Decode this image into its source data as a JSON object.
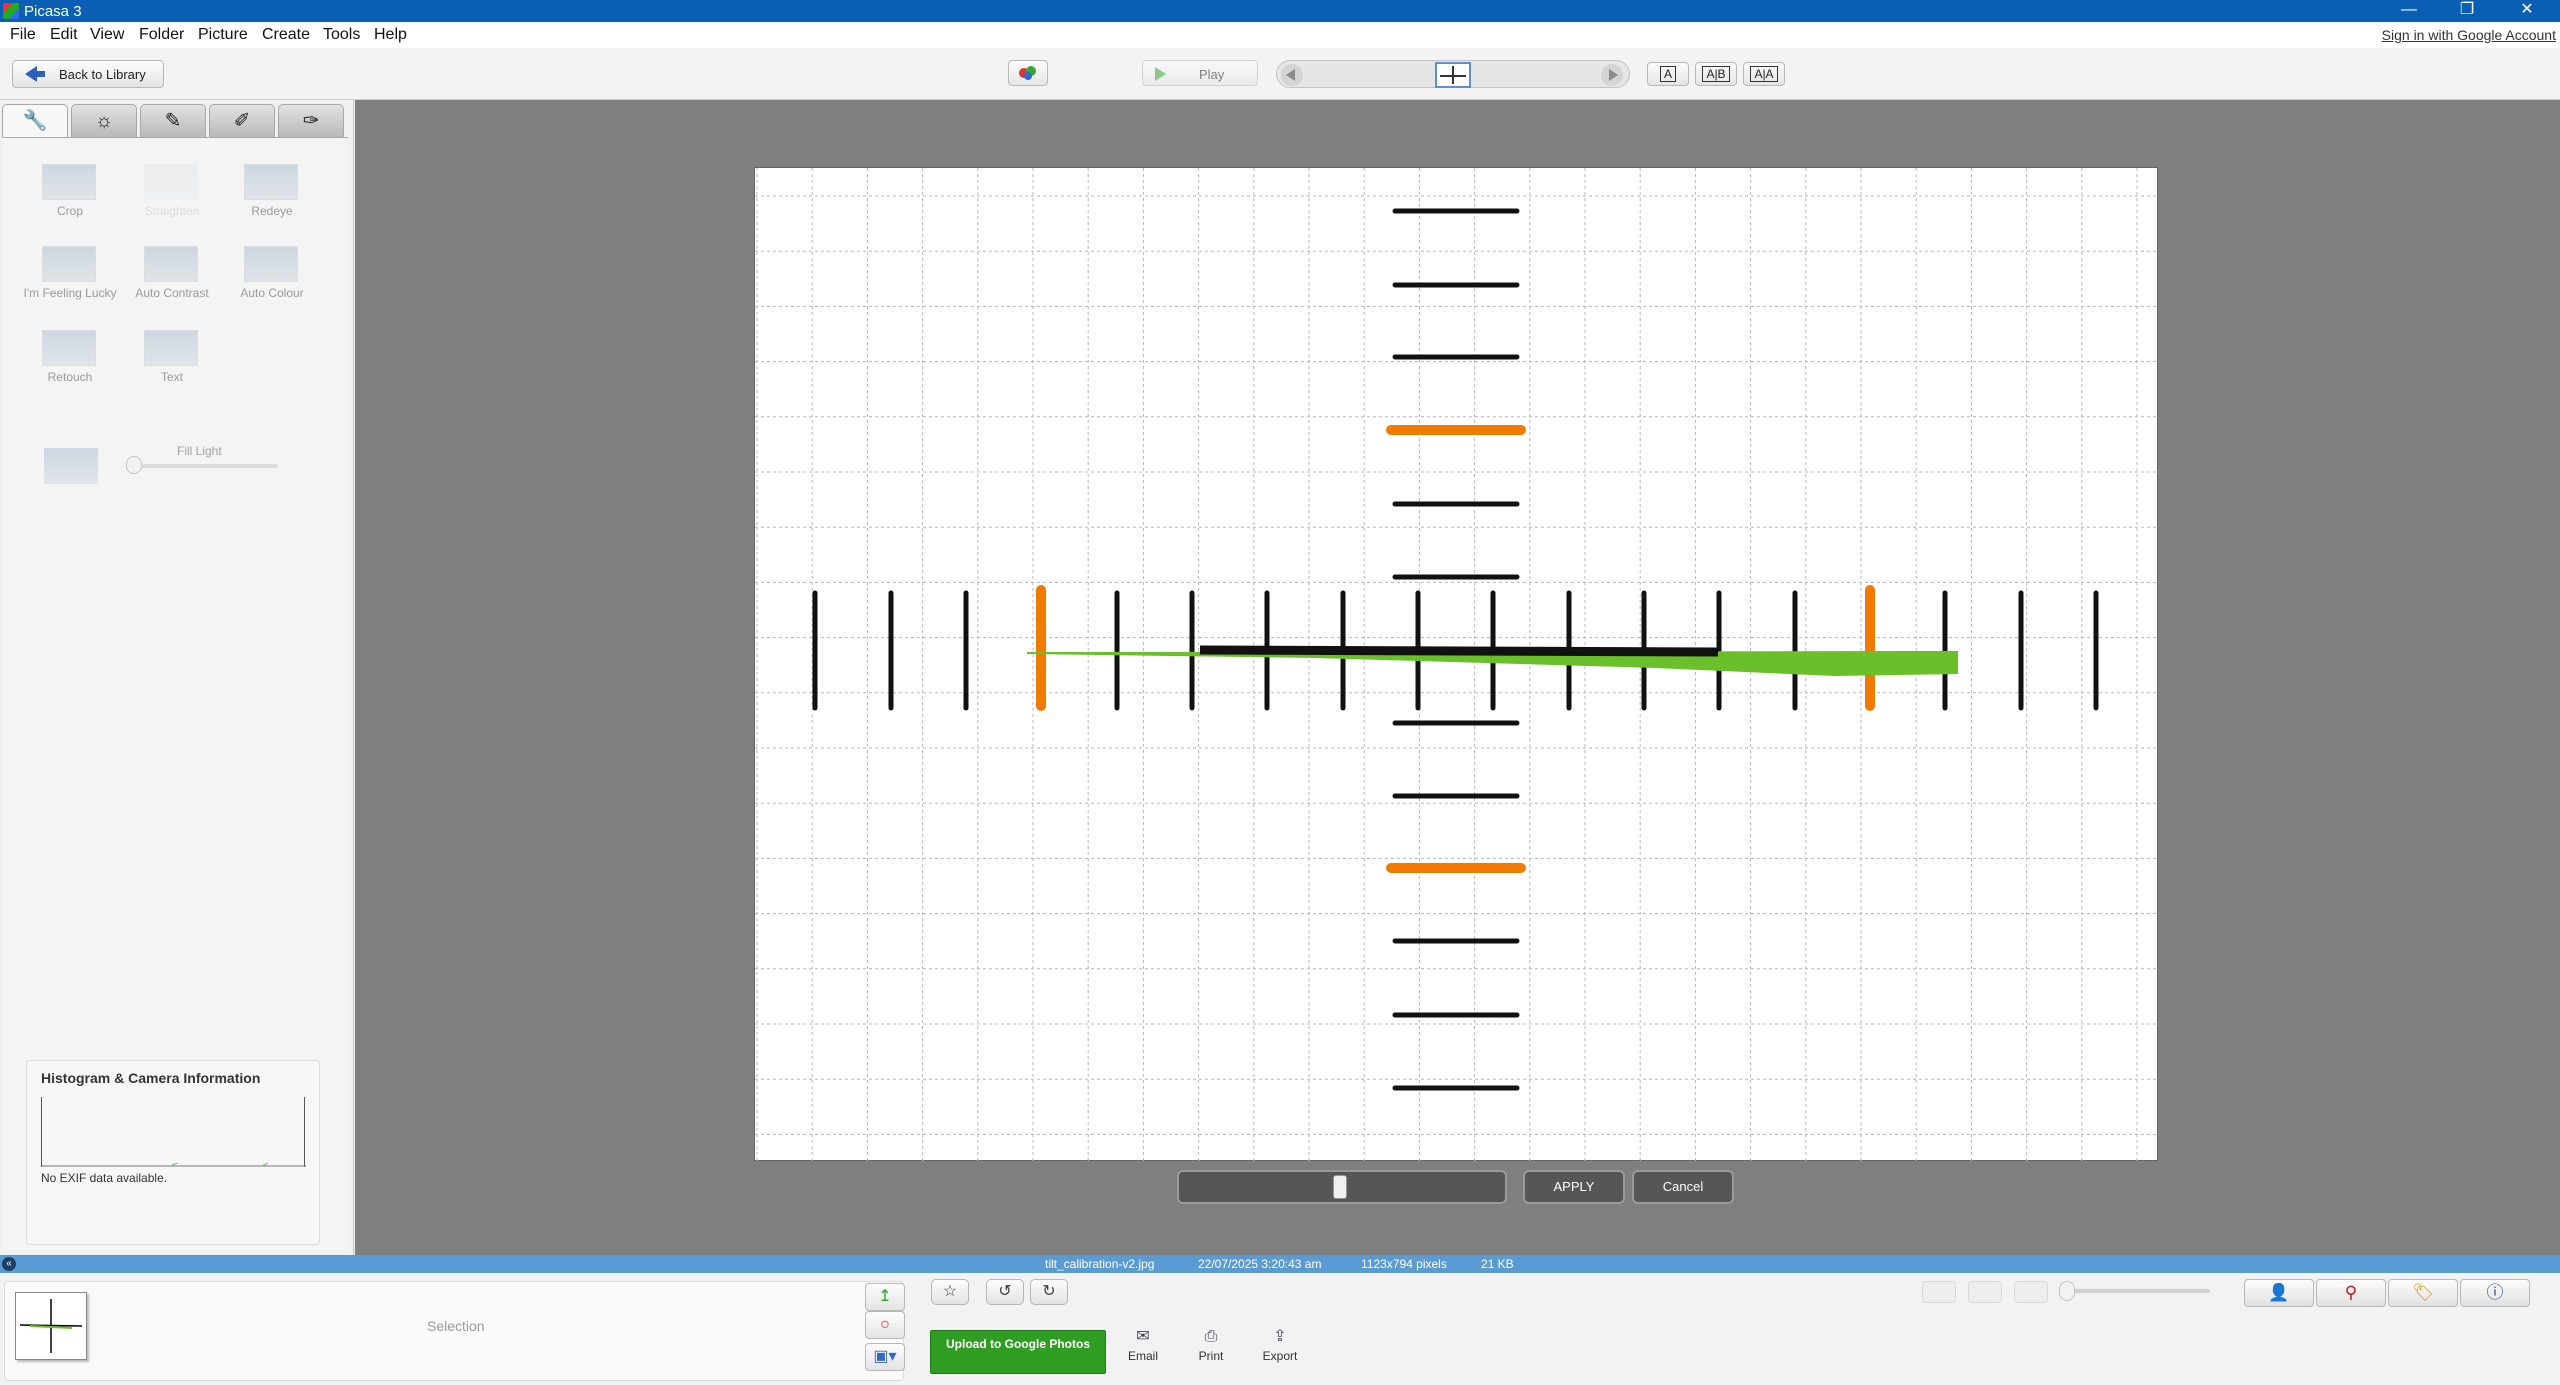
{
  "window": {
    "title": "Picasa 3",
    "controls": [
      "—",
      "❐",
      "✕"
    ]
  },
  "menu": {
    "items": [
      "File",
      "Edit",
      "View",
      "Folder",
      "Picture",
      "Create",
      "Tools",
      "Help"
    ],
    "signin": "Sign in with Google Account"
  },
  "toolbar": {
    "back_label": "Back to Library",
    "play_label": "Play",
    "view_modes": [
      "A",
      "A|B",
      "A|A"
    ]
  },
  "edit_tabs": [
    {
      "icon": "wrench-icon",
      "glyph": "🔧"
    },
    {
      "icon": "sun-icon",
      "glyph": "☼"
    },
    {
      "icon": "brush-icon",
      "glyph": "✎"
    },
    {
      "icon": "effects-brush-icon",
      "glyph": "✐"
    },
    {
      "icon": "effects-brush-blue-icon",
      "glyph": "✑"
    }
  ],
  "tools": [
    {
      "label": "Crop"
    },
    {
      "label": "Straighten"
    },
    {
      "label": "Redeye"
    },
    {
      "label": "I'm Feeling Lucky"
    },
    {
      "label": "Auto Contrast"
    },
    {
      "label": "Auto Colour"
    },
    {
      "label": "Retouch"
    },
    {
      "label": "Text"
    }
  ],
  "fill_light": {
    "label": "Fill Light",
    "level": 0
  },
  "histogram": {
    "title": "Histogram & Camera Information",
    "exif_text": "No EXIF data available."
  },
  "straighten": {
    "slider_level": 0.5,
    "apply_label": "APPLY",
    "cancel_label": "Cancel"
  },
  "status": {
    "filename": "tilt_calibration-v2.jpg",
    "datetime": "22/07/2025 3:20:43 am",
    "dimensions": "1123x794 pixels",
    "size": "21 KB"
  },
  "tray": {
    "selection_label": "Selection",
    "upload_label": "Upload to Google Photos",
    "actions": [
      {
        "label": "Email",
        "icon": "email-icon",
        "glyph": "✉"
      },
      {
        "label": "Print",
        "icon": "print-icon",
        "glyph": "⎙"
      },
      {
        "label": "Export",
        "icon": "export-icon",
        "glyph": "⇪"
      }
    ]
  },
  "colors": {
    "titlebar": "#0a5fb4",
    "status_bar": "#5a9bd4",
    "upload_green": "#2f9d22",
    "marker_orange": "#f07b00",
    "marker_green": "#6ac02a"
  }
}
